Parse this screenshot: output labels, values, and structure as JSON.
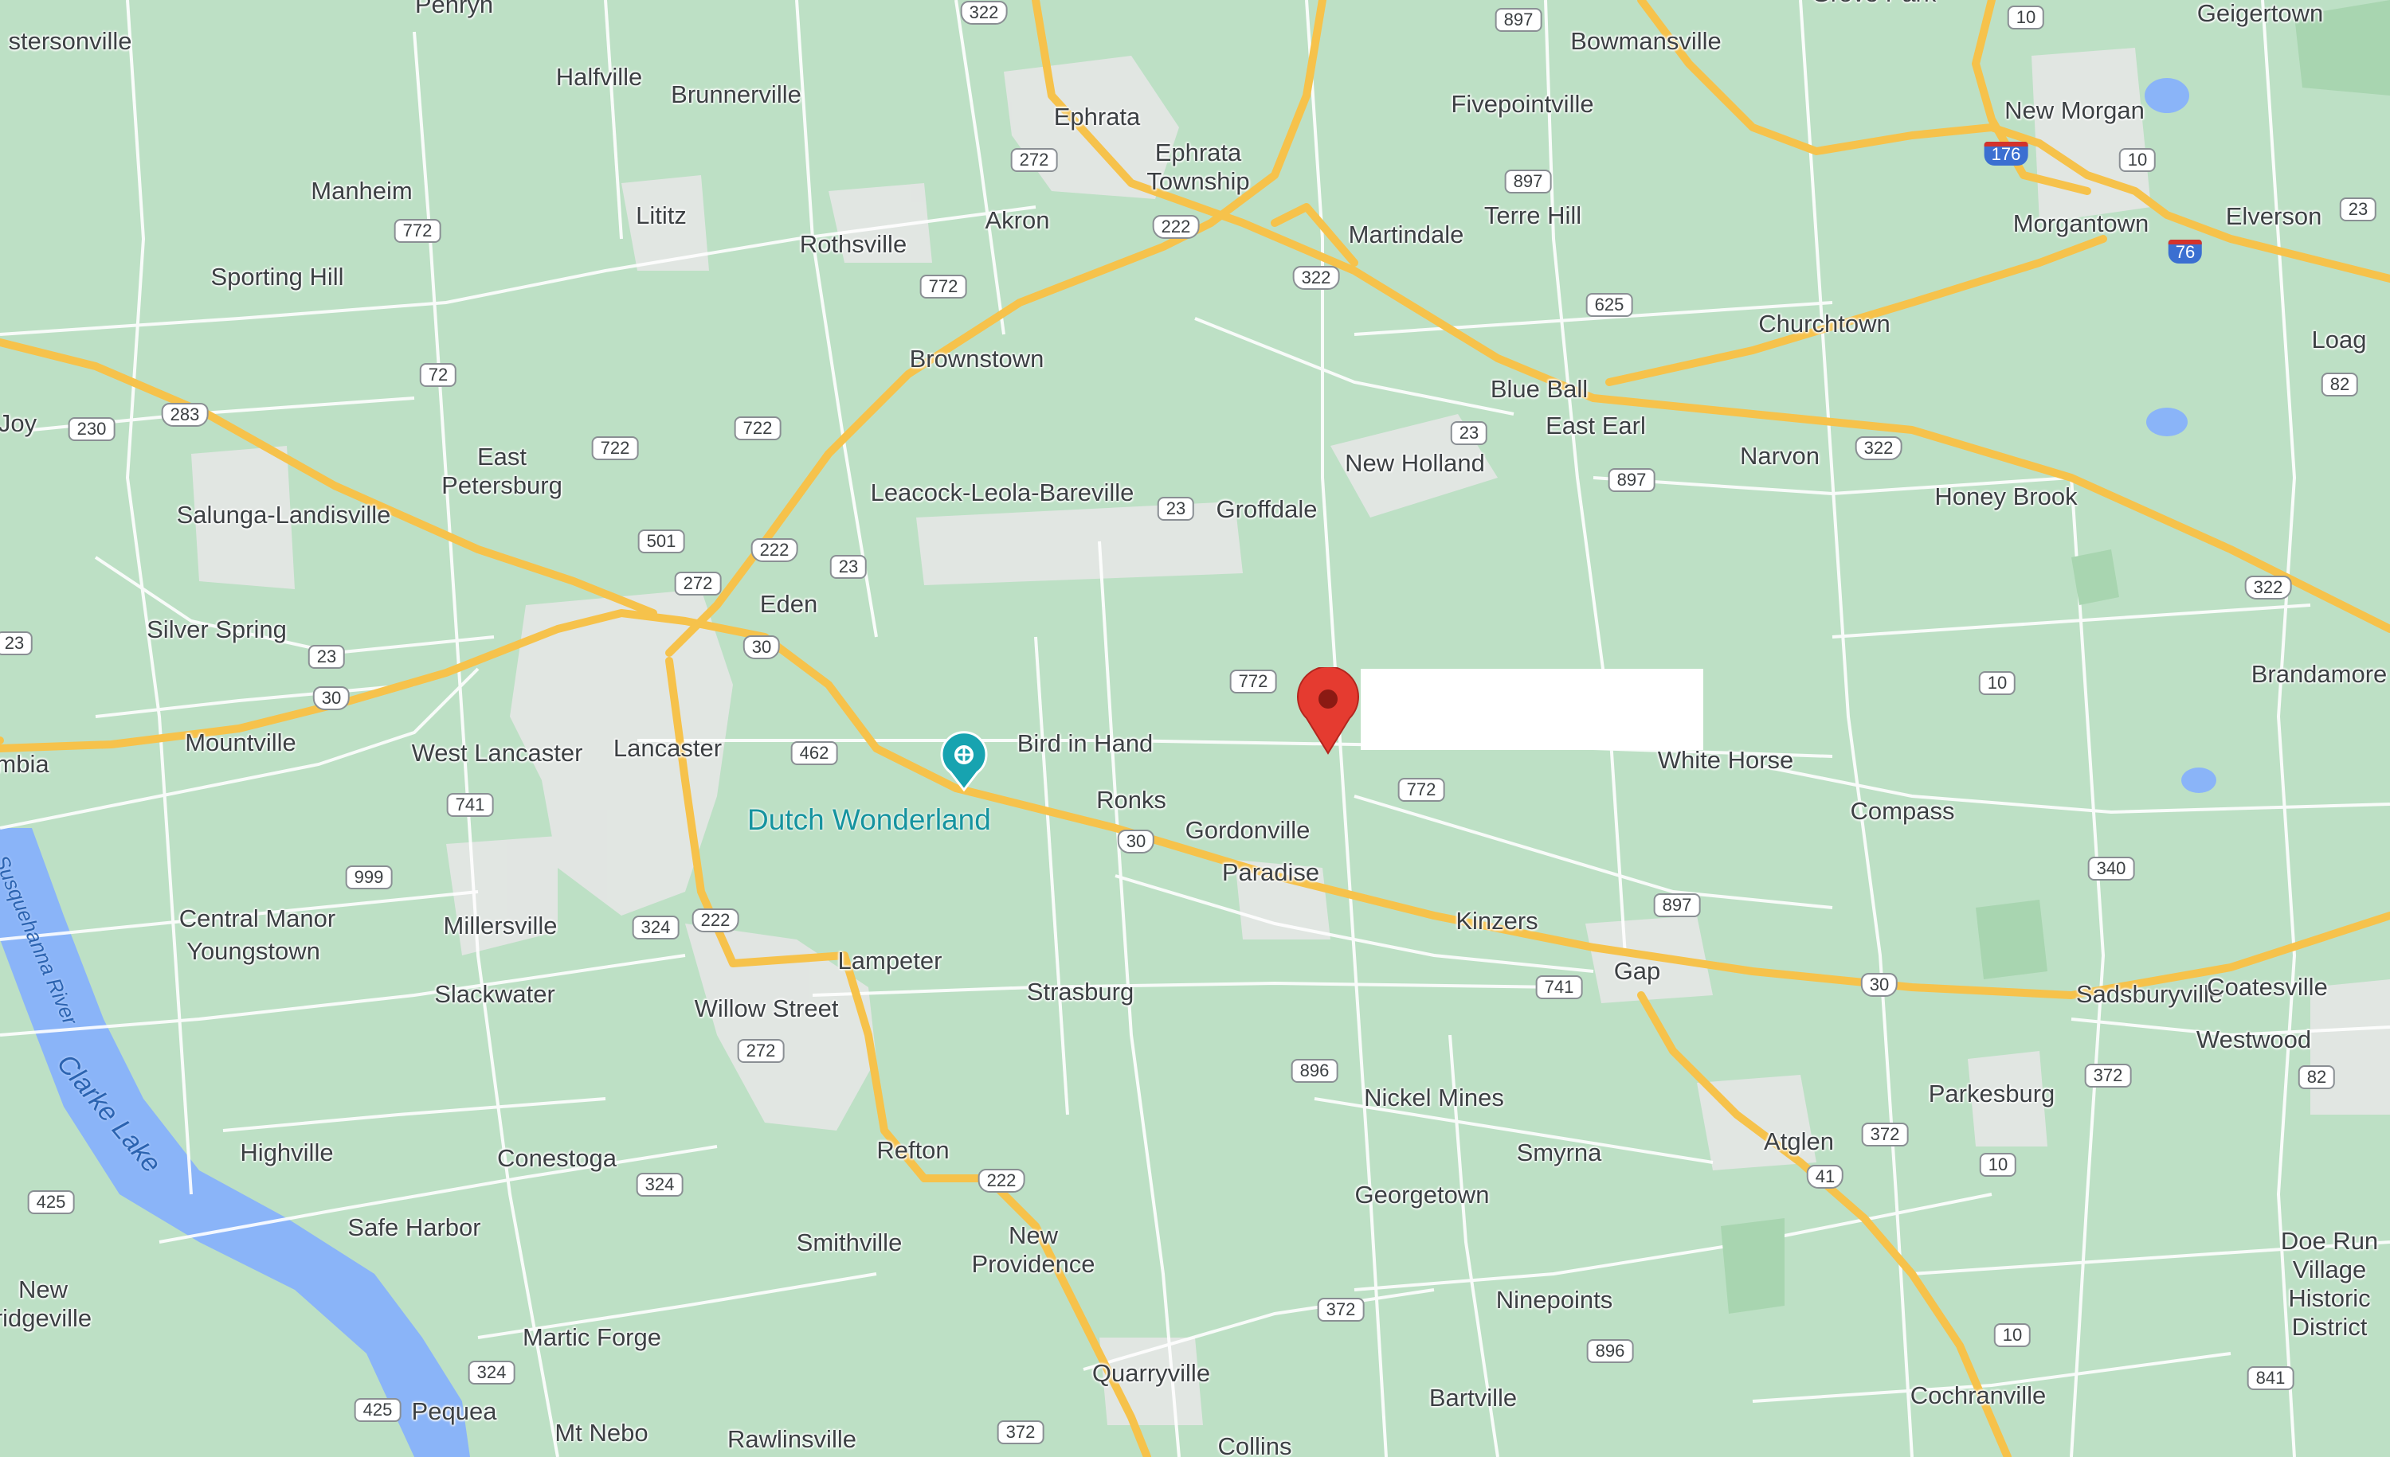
{
  "map": {
    "marker": {
      "name": "dropped-pin",
      "color": "#e53b30"
    },
    "poi": {
      "label": "Dutch Wonderland",
      "color": "#17a3b0"
    },
    "colors": {
      "land": "#bde0c5",
      "urban": "#e3e6e4",
      "road_major": "#f6c24b",
      "road_minor": "#ffffff",
      "water": "#8ab4f8"
    },
    "water_labels": [
      "Susquehanna River",
      "Clarke Lake"
    ],
    "places": [
      "stersonville",
      "Penryn",
      "Halfville",
      "Brunnerville",
      "Ephrata",
      "Ephrata\nTownship",
      "Bowmansville",
      "Fivepointville",
      "Grove Park",
      "Geigertown",
      "New Morgan",
      "Manheim",
      "Lititz",
      "Rothsville",
      "Akron",
      "Martindale",
      "Terre Hill",
      "Morgantown",
      "Elverson",
      "Sporting Hill",
      "Brownstown",
      "Churchtown",
      "Loag",
      "Joy",
      "East\nPetersburg",
      "Blue Ball",
      "East Earl",
      "Narvon",
      "New Holland",
      "Salunga-Landisville",
      "Leacock-Leola-Bareville",
      "Groffdale",
      "Honey Brook",
      "Eden",
      "Silver Spring",
      "Brandamore",
      "Mountville",
      "West Lancaster",
      "Lancaster",
      "Bird in Hand",
      "White Horse",
      "mbia",
      "Ronks",
      "Compass",
      "Gordonville",
      "Paradise",
      "Central Manor",
      "Youngstown",
      "Millersville",
      "Kinzers",
      "Lampeter",
      "Strasburg",
      "Gap",
      "Slackwater",
      "Willow Street",
      "Sadsburyville",
      "Coatesville",
      "Westwood",
      "Parkesburg",
      "Nickel Mines",
      "Highville",
      "Conestoga",
      "Refton",
      "Smyrna",
      "Atglen",
      "Georgetown",
      "Safe Harbor",
      "New\nProvidence",
      "Smithville",
      "Doe Run\nVillage\nHistoric\nDistrict",
      "New\nridgeville",
      "Ninepoints",
      "Martic Forge",
      "Quarryville",
      "Bartville",
      "Cochranville",
      "Pequea",
      "Mt Nebo",
      "Rawlinsville",
      "Collins"
    ],
    "route_shields": [
      {
        "num": "322",
        "kind": "us"
      },
      {
        "num": "897",
        "kind": "state"
      },
      {
        "num": "10",
        "kind": "state"
      },
      {
        "num": "272",
        "kind": "state"
      },
      {
        "num": "222",
        "kind": "us"
      },
      {
        "num": "772",
        "kind": "state"
      },
      {
        "num": "897",
        "kind": "state"
      },
      {
        "num": "322",
        "kind": "us"
      },
      {
        "num": "176",
        "kind": "interstate"
      },
      {
        "num": "10",
        "kind": "state"
      },
      {
        "num": "76",
        "kind": "interstate"
      },
      {
        "num": "23",
        "kind": "state"
      },
      {
        "num": "772",
        "kind": "state"
      },
      {
        "num": "72",
        "kind": "state"
      },
      {
        "num": "625",
        "kind": "state"
      },
      {
        "num": "283",
        "kind": "us"
      },
      {
        "num": "230",
        "kind": "state"
      },
      {
        "num": "722",
        "kind": "state"
      },
      {
        "num": "722",
        "kind": "state"
      },
      {
        "num": "23",
        "kind": "state"
      },
      {
        "num": "322",
        "kind": "us"
      },
      {
        "num": "82",
        "kind": "state"
      },
      {
        "num": "897",
        "kind": "state"
      },
      {
        "num": "23",
        "kind": "state"
      },
      {
        "num": "501",
        "kind": "state"
      },
      {
        "num": "222",
        "kind": "us"
      },
      {
        "num": "23",
        "kind": "state"
      },
      {
        "num": "272",
        "kind": "state"
      },
      {
        "num": "322",
        "kind": "us"
      },
      {
        "num": "23",
        "kind": "state"
      },
      {
        "num": "23",
        "kind": "state"
      },
      {
        "num": "30",
        "kind": "us"
      },
      {
        "num": "30",
        "kind": "us"
      },
      {
        "num": "772",
        "kind": "state"
      },
      {
        "num": "10",
        "kind": "state"
      },
      {
        "num": "462",
        "kind": "state"
      },
      {
        "num": "772",
        "kind": "state"
      },
      {
        "num": "741",
        "kind": "state"
      },
      {
        "num": "30",
        "kind": "us"
      },
      {
        "num": "340",
        "kind": "state"
      },
      {
        "num": "999",
        "kind": "state"
      },
      {
        "num": "897",
        "kind": "state"
      },
      {
        "num": "324",
        "kind": "state"
      },
      {
        "num": "222",
        "kind": "us"
      },
      {
        "num": "741",
        "kind": "state"
      },
      {
        "num": "30",
        "kind": "us"
      },
      {
        "num": "272",
        "kind": "state"
      },
      {
        "num": "896",
        "kind": "state"
      },
      {
        "num": "372",
        "kind": "state"
      },
      {
        "num": "82",
        "kind": "state"
      },
      {
        "num": "372",
        "kind": "state"
      },
      {
        "num": "10",
        "kind": "state"
      },
      {
        "num": "41",
        "kind": "us"
      },
      {
        "num": "222",
        "kind": "us"
      },
      {
        "num": "324",
        "kind": "state"
      },
      {
        "num": "425",
        "kind": "state"
      },
      {
        "num": "372",
        "kind": "state"
      },
      {
        "num": "10",
        "kind": "state"
      },
      {
        "num": "896",
        "kind": "state"
      },
      {
        "num": "841",
        "kind": "state"
      },
      {
        "num": "324",
        "kind": "state"
      },
      {
        "num": "425",
        "kind": "state"
      },
      {
        "num": "372",
        "kind": "state"
      }
    ]
  }
}
